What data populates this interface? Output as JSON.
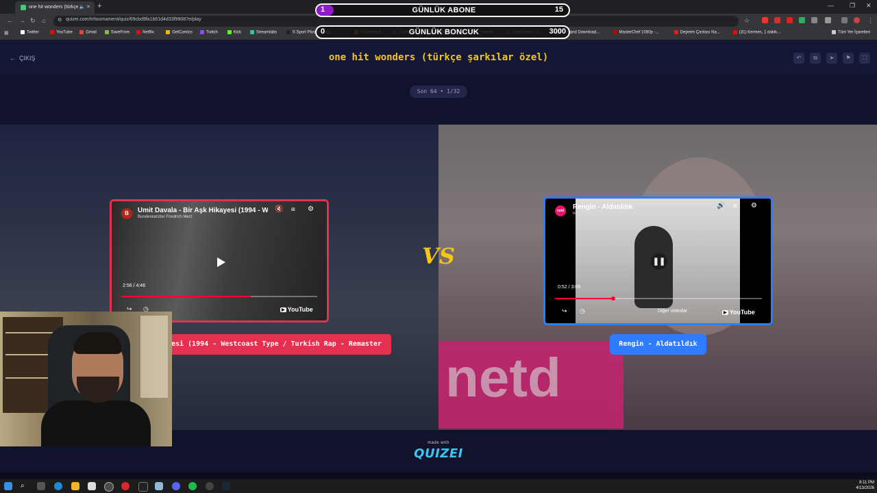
{
  "browser": {
    "tab_title": "one hit wonders (türkçe şa",
    "url": "quizei.com/tr/tournament/quiz/69cbd9fa1b61d4d33f98087e/play",
    "new_tab_symbol": "+",
    "bookmarks": [
      {
        "label": "Twitter",
        "color": "#ffffff"
      },
      {
        "label": "YouTube",
        "color": "#ff0000"
      },
      {
        "label": "Gmail",
        "color": "#ea4335"
      },
      {
        "label": "SaveFrom",
        "color": "#7bc043"
      },
      {
        "label": "Netflix",
        "color": "#e50914"
      },
      {
        "label": "GetComics",
        "color": "#f4b400"
      },
      {
        "label": "Twitch",
        "color": "#9146ff"
      },
      {
        "label": "Kick",
        "color": "#53fc18"
      },
      {
        "label": "Streamlabs",
        "color": "#31c3a2"
      },
      {
        "label": "S Sport Plus-İstediği...",
        "color": "#222222"
      },
      {
        "label": "Crunchyroll",
        "color": "#f47521"
      },
      {
        "label": "Cuttly",
        "color": "#2d6cdf"
      },
      {
        "label": "NBA Games",
        "color": "#1d428a"
      },
      {
        "label": "VirusTotal - Home",
        "color": "#394eff"
      },
      {
        "label": "GeoGuessr - L...",
        "color": "#a3238e"
      },
      {
        "label": "Cut and Download...",
        "color": "#cccccc"
      },
      {
        "label": "MasterChef 1080p -...",
        "color": "#c00000"
      },
      {
        "label": "Deprem Çantası Na...",
        "color": "#e11d1d"
      },
      {
        "label": "(31) Kermes, 1 dakik...",
        "color": "#ff0000"
      }
    ],
    "other_bookmarks": "Tüm Yer İşaretleri"
  },
  "overlay": {
    "subs_count": "1",
    "subs_title": "GÜNLÜK ABONE",
    "subs_goal": "15",
    "beads_count": "0",
    "beads_title": "GÜNLÜK BONCUK",
    "beads_goal": "3000",
    "fill_color": "#8e1dc4"
  },
  "quiz": {
    "exit_label": "ÇIKIŞ",
    "title": "one hit wonders (türkçe şarkılar özel)",
    "round": "Son 64 • 1/32",
    "vs": "VS",
    "left": {
      "channel_initial": "B",
      "video_title": "Ümit Davala - Bir Aşk Hikayesi (1994 - We",
      "channel_name": "Bundeskanzler Friedrich Merz",
      "time": "2:56 / 4:46",
      "progress": 0.66,
      "label": "Ümit Davala - Bir Aşk Hikayesi (1994 - Westcoast Type / Turkish Rap - Remaster",
      "border_color": "#e5304f"
    },
    "right": {
      "channel_initial": "netd",
      "video_title": "Rengin - Aldatıldık",
      "channel_name": "netd müzik",
      "time": "0:52 / 3:09",
      "progress": 0.28,
      "more_videos": "Diğer videolar",
      "label": "Rengin - Aldatıldık",
      "border_color": "#2f7cff"
    },
    "youtube_label": "YouTube",
    "made_with": "made with",
    "brand": "QUIZEI",
    "accent": "#f5c518"
  },
  "taskbar": {
    "time": "8:11 PM",
    "date": "4/13/2026"
  }
}
